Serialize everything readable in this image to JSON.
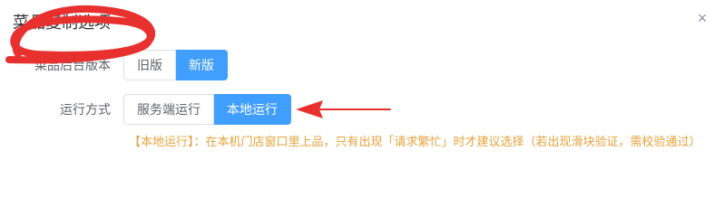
{
  "dialog": {
    "title": "菜品复制选项",
    "close_glyph": "×"
  },
  "version_row": {
    "label": "菜品后台版本",
    "options": [
      "旧版",
      "新版"
    ],
    "selected": "新版"
  },
  "mode_row": {
    "label": "运行方式",
    "options": [
      "服务端运行",
      "本地运行"
    ],
    "selected": "本地运行"
  },
  "note": "【本地运行】：在本机门店窗口里上品，只有出现「请求繁忙」时才建议选择（若出现滑块验证，需校验通过）",
  "colors": {
    "accent": "#409eff",
    "warning_text": "#e6a23c",
    "annotation_red": "#e8312f"
  },
  "icons": {
    "close": "close-icon"
  }
}
